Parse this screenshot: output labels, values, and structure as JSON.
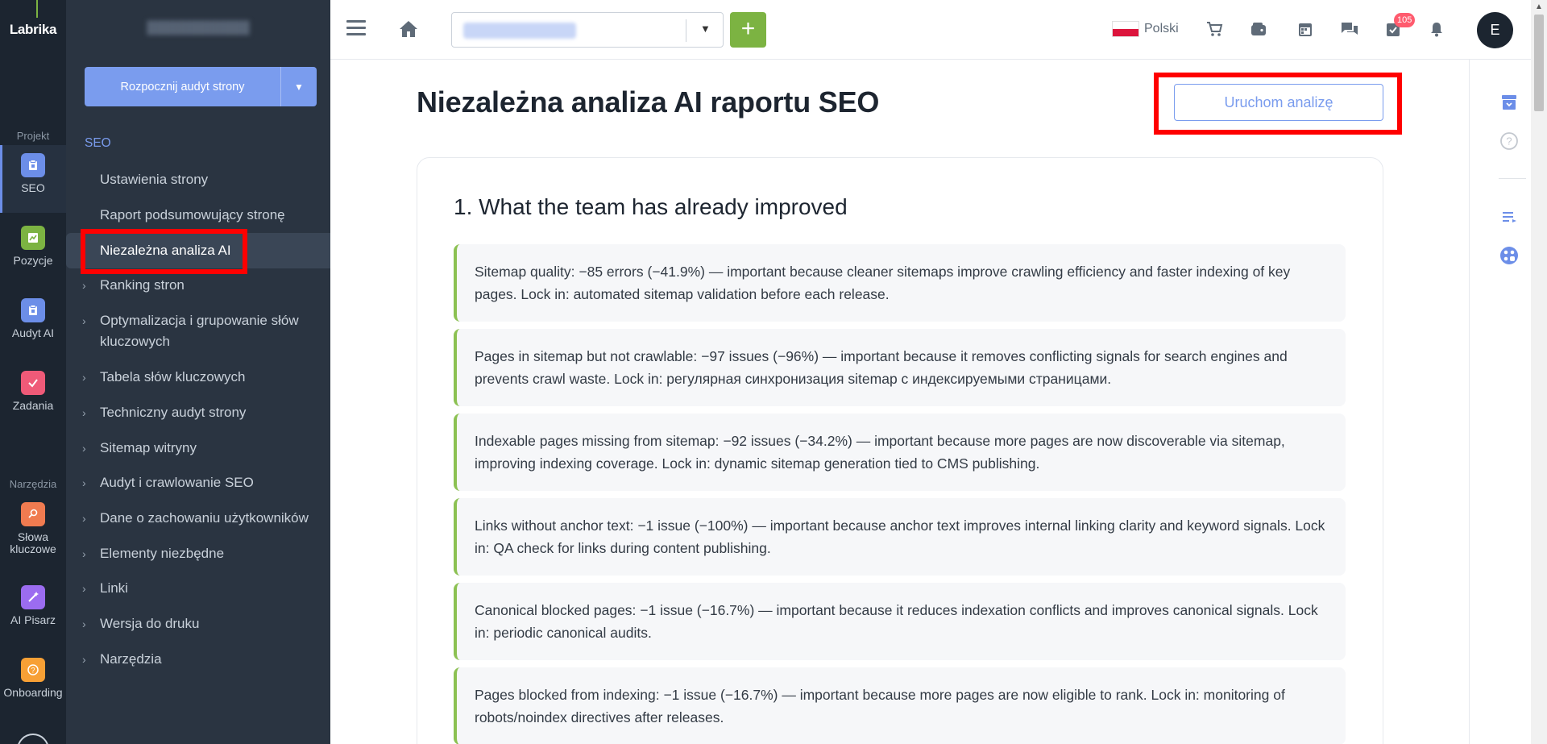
{
  "brand": {
    "name": "Labrika"
  },
  "rail": {
    "section_project": "Projekt",
    "section_tools": "Narzędzia",
    "items": [
      {
        "label": "SEO",
        "icon": "seo-icon",
        "color": "#6c8ee8"
      },
      {
        "label": "Pozycje",
        "icon": "chart-icon",
        "color": "#7cb342"
      },
      {
        "label": "Audyt AI",
        "icon": "ai-audit-icon",
        "color": "#6c8ee8"
      },
      {
        "label": "Zadania",
        "icon": "check-icon",
        "color": "#ef5a78"
      },
      {
        "label": "Słowa\nkluczowe",
        "icon": "key-icon",
        "color": "#f07b50"
      },
      {
        "label": "AI Pisarz",
        "icon": "wand-icon",
        "color": "#9b6cf0"
      },
      {
        "label": "Onboarding",
        "icon": "question-icon",
        "color": "#f7a035"
      }
    ]
  },
  "sidebar": {
    "audit_button": "Rozpocznij audyt strony",
    "heading": "SEO",
    "items": [
      {
        "label": "Ustawienia strony"
      },
      {
        "label": "Raport podsumowujący stronę"
      },
      {
        "label": "Niezależna analiza AI"
      },
      {
        "label": "Ranking stron"
      },
      {
        "label": "Optymalizacja i grupowanie słów kluczowych"
      },
      {
        "label": "Tabela słów kluczowych"
      },
      {
        "label": "Techniczny audyt strony"
      },
      {
        "label": "Sitemap witryny"
      },
      {
        "label": "Audyt i crawlowanie SEO"
      },
      {
        "label": "Dane o zachowaniu użytkowników"
      },
      {
        "label": "Elementy niezbędne"
      },
      {
        "label": "Linki"
      },
      {
        "label": "Wersja do druku"
      },
      {
        "label": "Narzędzia"
      }
    ]
  },
  "topbar": {
    "language": "Polski",
    "notifications_badge": "105",
    "avatar_letter": "E",
    "add_label": "+"
  },
  "main": {
    "title": "Niezależna analiza AI raportu SEO",
    "run_button": "Uruchom analizę",
    "section_heading": "1. What the team has already improved",
    "items": [
      "Sitemap quality: −85 errors (−41.9%) — important because cleaner sitemaps improve crawling efficiency and faster indexing of key pages. Lock in: automated sitemap validation before each release.",
      "Pages in sitemap but not crawlable: −97 issues (−96%) — important because it removes conflicting signals for search engines and prevents crawl waste. Lock in: регулярная синхронизация sitemap с индексируемыми страницами.",
      "Indexable pages missing from sitemap: −92 issues (−34.2%) — important because more pages are now discoverable via sitemap, improving indexing coverage. Lock in: dynamic sitemap generation tied to CMS publishing.",
      "Links without anchor text: −1 issue (−100%) — important because anchor text improves internal linking clarity and keyword signals. Lock in: QA check for links during content publishing.",
      "Canonical blocked pages: −1 issue (−16.7%) — important because it reduces indexation conflicts and improves canonical signals. Lock in: periodic canonical audits.",
      "Pages blocked from indexing: −1 issue (−16.7%) — important because more pages are now eligible to rank. Lock in: monitoring of robots/noindex directives after releases."
    ]
  },
  "colors": {
    "accent": "#7a9cee",
    "green": "#7cb342",
    "highlight": "#ff0000",
    "sidebar_bg": "#2a3441",
    "rail_bg": "#1c2530"
  }
}
